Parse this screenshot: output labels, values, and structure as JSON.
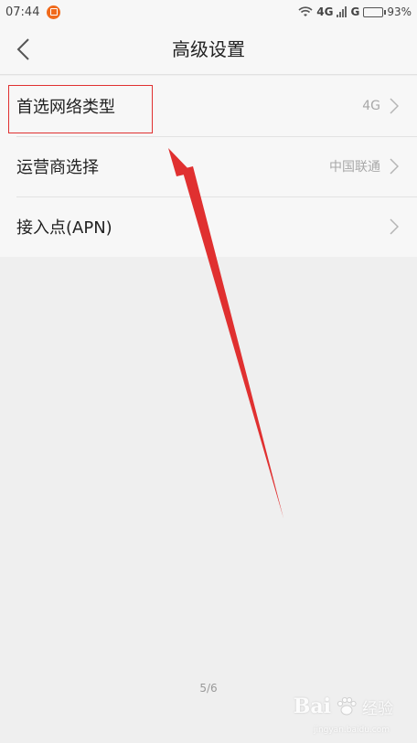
{
  "status_bar": {
    "time": "07:44",
    "network_1": "4G",
    "network_2": "G",
    "battery_percent": "93%",
    "battery_level": 0.93
  },
  "header": {
    "title": "高级设置"
  },
  "settings": {
    "items": [
      {
        "label": "首选网络类型",
        "value": "4G"
      },
      {
        "label": "运营商选择",
        "value": "中国联通"
      },
      {
        "label": "接入点(APN)",
        "value": ""
      }
    ]
  },
  "page_indicator": "5/6",
  "watermark": {
    "brand": "Bai",
    "sub": "经验",
    "url": "jingyan.baidu.com"
  },
  "colors": {
    "accent_red": "#e03030",
    "app_icon": "#f06a1c"
  }
}
